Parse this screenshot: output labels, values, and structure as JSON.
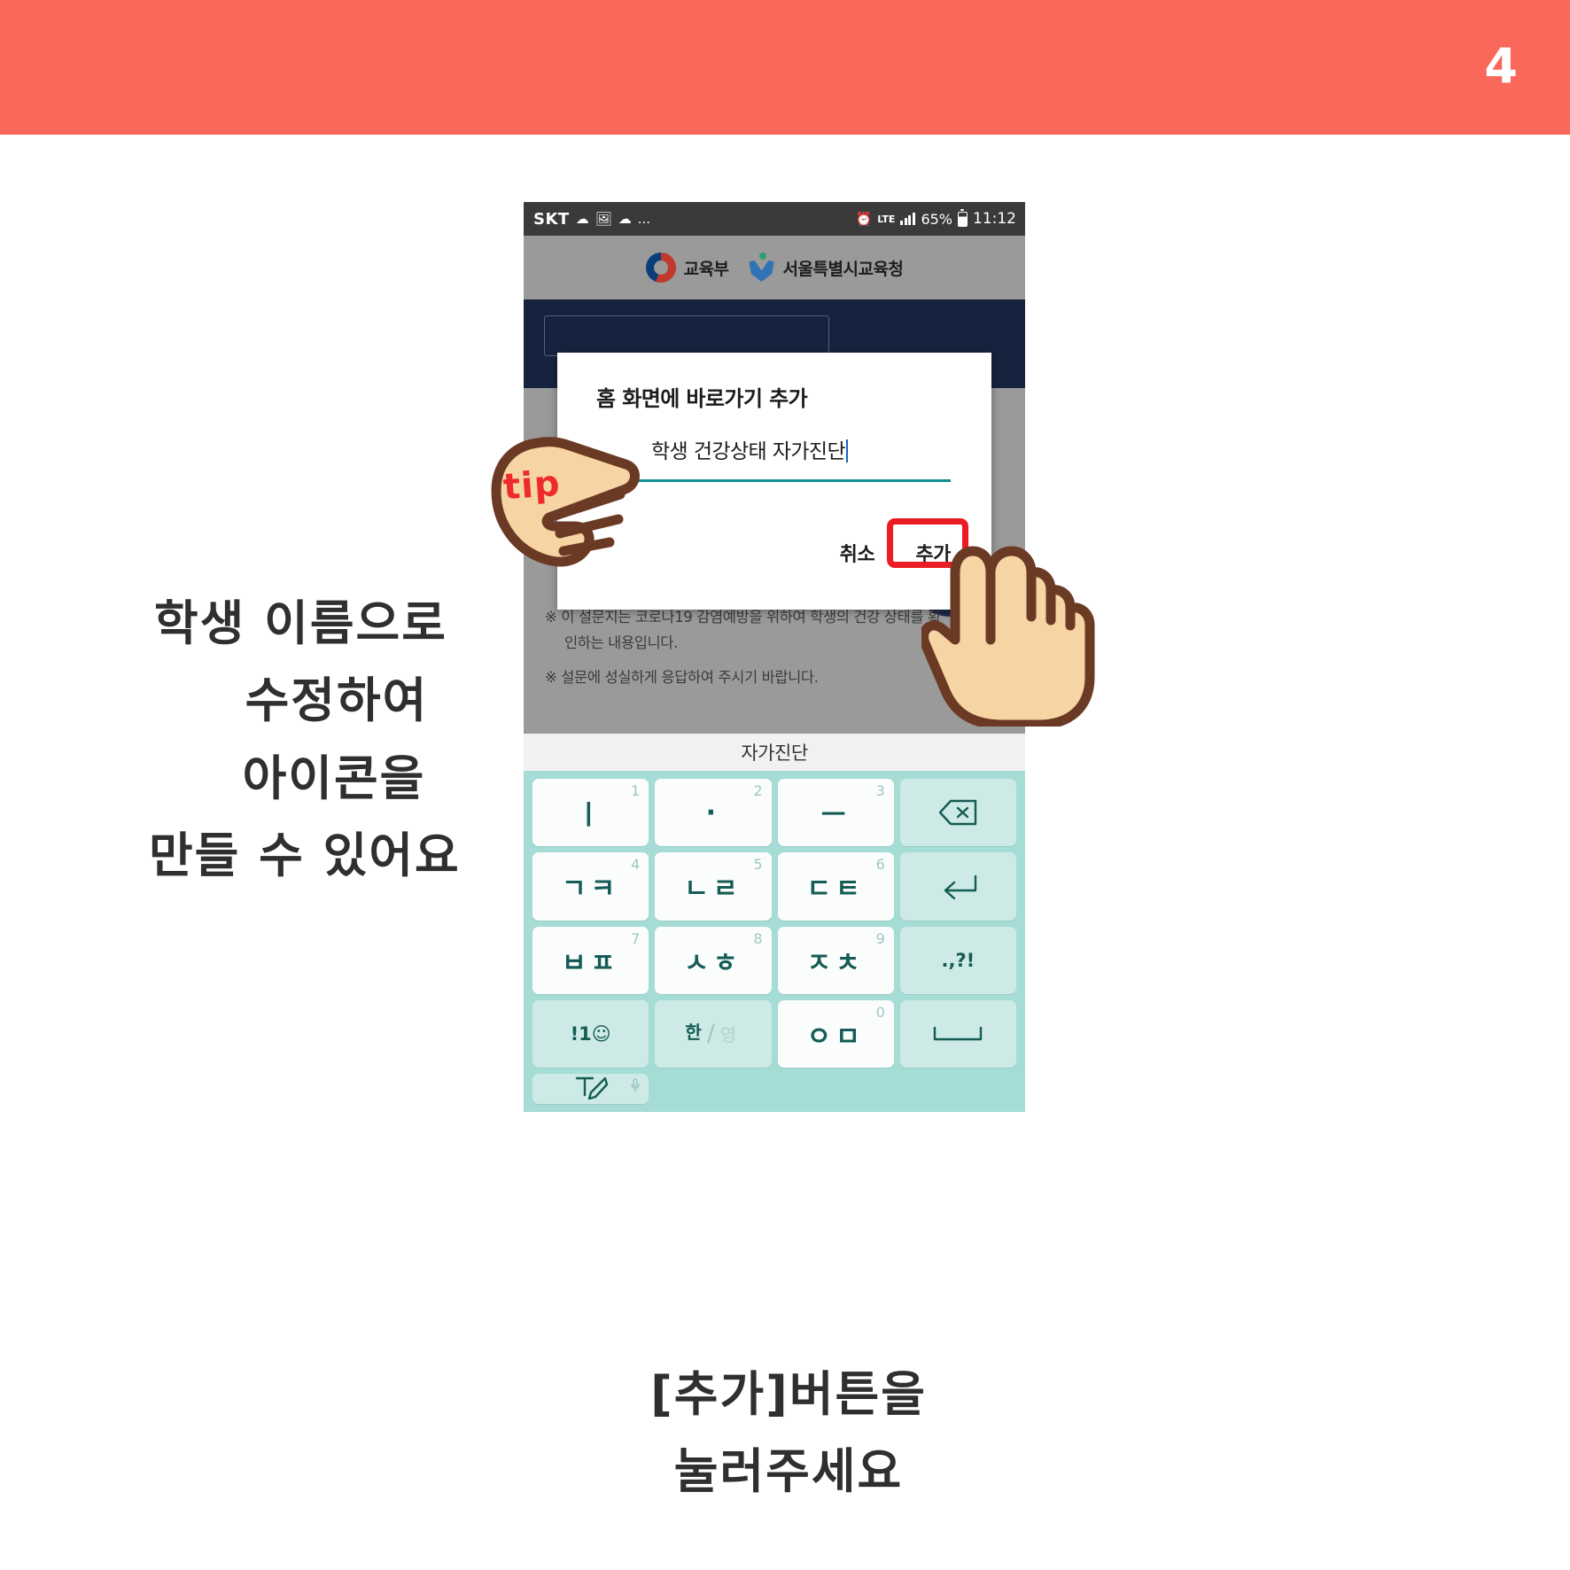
{
  "banner": {
    "page_number": "4",
    "color": "#f9685a"
  },
  "notes": {
    "left": {
      "lines": [
        "학생 이름으로",
        "수정하여",
        "아이콘을",
        "만들 수 있어요"
      ]
    },
    "bottom": {
      "lines": [
        "[추가]버튼을",
        "눌러주세요"
      ]
    },
    "tip_label": "tip"
  },
  "phone": {
    "statusbar": {
      "carrier": "SKT",
      "left_icons": [
        "cloud-icon",
        "image-icon",
        "cloud-icon",
        "more-dots-icon"
      ],
      "more": "...",
      "alarm_icon": "alarm-icon",
      "network": "LTE",
      "signal_icon": "signal-bars-icon",
      "battery_percent": "65%",
      "battery_icon": "battery-icon",
      "time": "11:12"
    },
    "app_header": {
      "moe_logo_label": "교육부",
      "sen_logo_label": "서울특별시교육청"
    },
    "dialog": {
      "title": "홈 화면에 바로가기 추가",
      "input_value": "학생 건강상태 자가진단",
      "cancel_label": "취소",
      "add_label": "추가",
      "highlight_color": "#ec1c24",
      "underline_color": "#0f8f8f"
    },
    "background_notes": {
      "line1": "※ 이 설문지는 코로나19 감염예방을 위하여 학생의 건강 상태를 확",
      "line1b": "인하는 내용입니다.",
      "line2": "※ 설문에 성실하게 응답하여 주시기 바랍니다."
    },
    "keyboard": {
      "suggestion": "자가진단",
      "theme_color": "#a6dcd6",
      "keys": [
        {
          "label": "ㅣ",
          "num": "1",
          "type": "char",
          "name": "key-vowel-i"
        },
        {
          "label": "·",
          "num": "2",
          "type": "char",
          "name": "key-vowel-dot"
        },
        {
          "label": "ㅡ",
          "num": "3",
          "type": "char",
          "name": "key-vowel-eu"
        },
        {
          "label": "",
          "num": "",
          "type": "fn",
          "name": "key-backspace",
          "icon": "backspace-icon"
        },
        {
          "label": "ㄱㅋ",
          "num": "4",
          "type": "char",
          "name": "key-giyeok-kieuk"
        },
        {
          "label": "ㄴㄹ",
          "num": "5",
          "type": "char",
          "name": "key-nieun-rieul"
        },
        {
          "label": "ㄷㅌ",
          "num": "6",
          "type": "char",
          "name": "key-digeut-tieut"
        },
        {
          "label": "",
          "num": "",
          "type": "fn",
          "name": "key-enter",
          "icon": "enter-icon"
        },
        {
          "label": "ㅂㅍ",
          "num": "7",
          "type": "char",
          "name": "key-bieup-pieup"
        },
        {
          "label": "ㅅㅎ",
          "num": "8",
          "type": "char",
          "name": "key-siot-hieut"
        },
        {
          "label": "ㅈㅊ",
          "num": "9",
          "type": "char",
          "name": "key-jieut-chieut"
        },
        {
          "label": ".,?!",
          "num": "",
          "type": "fn",
          "name": "key-punctuation"
        },
        {
          "label": "!1☺",
          "num": "",
          "type": "fn",
          "name": "key-symbols"
        },
        {
          "label": "한/영",
          "num": "",
          "type": "fn",
          "name": "key-language-toggle",
          "top": "한",
          "bottom": "영"
        },
        {
          "label": "ㅇㅁ",
          "num": "0",
          "type": "char",
          "name": "key-ieung-mieum"
        },
        {
          "label": "",
          "num": "",
          "type": "fn",
          "name": "key-space",
          "icon": "space-icon"
        },
        {
          "label": "",
          "num": "",
          "type": "fn",
          "name": "key-handwriting",
          "icon": "handwriting-icon"
        }
      ]
    }
  }
}
